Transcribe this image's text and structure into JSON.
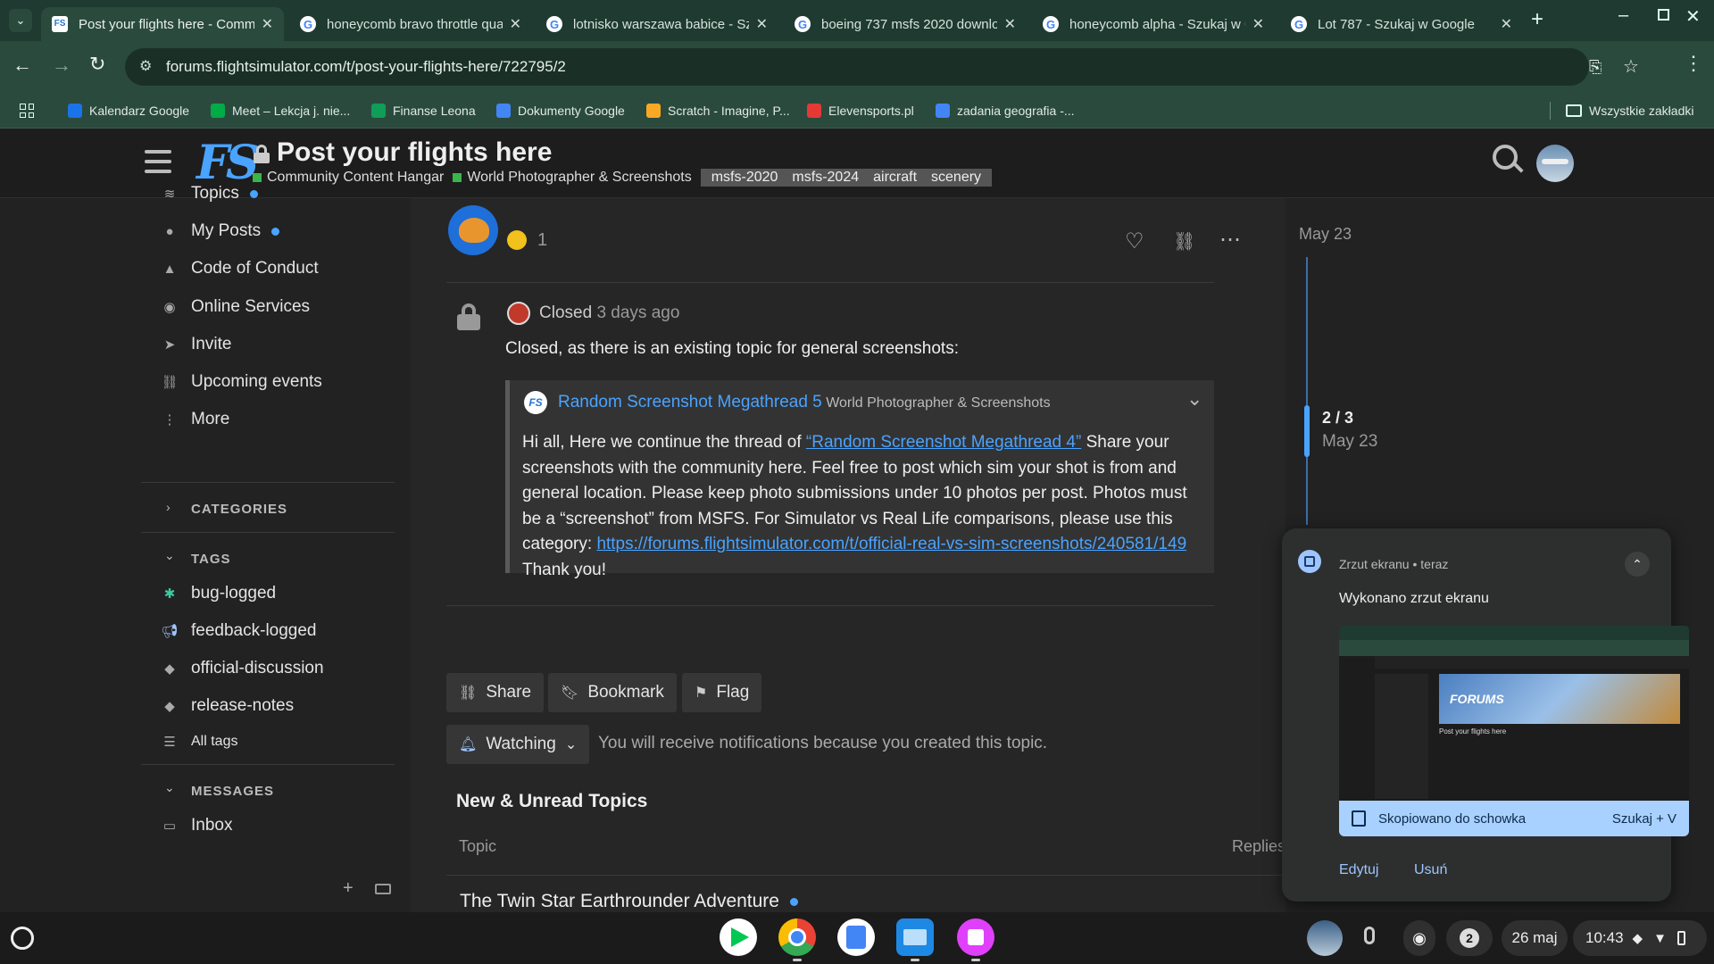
{
  "browser": {
    "tabs": [
      {
        "title": "Post your flights here - Commu",
        "active": true
      },
      {
        "title": "honeycomb bravo throttle qua"
      },
      {
        "title": "lotnisko warszawa babice - Sz"
      },
      {
        "title": "boeing 737 msfs 2020 downlo"
      },
      {
        "title": "honeycomb alpha - Szukaj w G"
      },
      {
        "title": "Lot 787 - Szukaj w Google"
      }
    ],
    "url": "forums.flightsimulator.com/t/post-your-flights-here/722795/2",
    "bookmarks": [
      {
        "label": "Kalendarz Google",
        "color": "#1a73e8"
      },
      {
        "label": "Meet – Lekcja j. nie...",
        "color": "#00ac47"
      },
      {
        "label": "Finanse Leona",
        "color": "#0f9d58"
      },
      {
        "label": "Dokumenty Google",
        "color": "#4285f4"
      },
      {
        "label": "Scratch - Imagine, P...",
        "color": "#f9a825"
      },
      {
        "label": "Elevensports.pl",
        "color": "#e53935"
      },
      {
        "label": "zadania geografia -...",
        "color": "#4285f4"
      }
    ],
    "all_bookmarks": "Wszystkie zakładki"
  },
  "forum": {
    "logo": "FS",
    "topic_title": "Post your flights here",
    "category1": "Community Content Hangar",
    "category2": "World Photographer & Screenshots",
    "tags": [
      "msfs-2020",
      "msfs-2024",
      "aircraft",
      "scenery"
    ],
    "cat1_color": "#3ab54a",
    "cat2_color": "#3ab54a"
  },
  "sidebar": {
    "items": [
      {
        "label": "Topics",
        "icon": "layers-icon",
        "dot": true
      },
      {
        "label": "My Posts",
        "icon": "user-icon",
        "dot": true
      },
      {
        "label": "Code of Conduct",
        "icon": "warning-icon"
      },
      {
        "label": "Online Services",
        "icon": "eye-icon"
      },
      {
        "label": "Invite",
        "icon": "paper-plane-icon"
      },
      {
        "label": "Upcoming events",
        "icon": "link-icon"
      },
      {
        "label": "More",
        "icon": "more-vertical-icon"
      }
    ],
    "categories_heading": "CATEGORIES",
    "tags_heading": "TAGS",
    "tags": [
      {
        "label": "bug-logged",
        "icon": "bug-icon"
      },
      {
        "label": "feedback-logged",
        "icon": "megaphone-icon"
      },
      {
        "label": "official-discussion",
        "icon": "tag-icon"
      },
      {
        "label": "release-notes",
        "icon": "tag-icon"
      }
    ],
    "all_tags": "All tags",
    "messages_heading": "MESSAGES",
    "inbox": "Inbox"
  },
  "post": {
    "reaction_count": "1",
    "closed_label": "Closed",
    "closed_time": "3 days ago",
    "body": "Closed, as there is an existing topic for general screenshots:",
    "quote_title": "Random Screenshot Megathread 5",
    "quote_category": "World Photographer & Screenshots",
    "quote_text_1": "Hi all, Here we continue the thread of ",
    "quote_link_1": "“Random Screenshot Megathread 4”",
    "quote_text_2": " Share your screenshots with the community here. Feel free to post which sim your shot is from and general location. Please keep photo submissions under 10 photos per post. Photos must be a “screenshot” from MSFS. For Simulator vs Real Life comparisons, please use this category: ",
    "quote_link_2": "https://forums.flightsimulator.com/t/official-real-vs-sim-screenshots/240581/149",
    "quote_text_3": " Thank you!"
  },
  "actions": {
    "share": "Share",
    "bookmark": "Bookmark",
    "flag": "Flag",
    "watching": "Watching",
    "watching_note": "You will receive notifications because you created this topic."
  },
  "topics_list": {
    "heading": "New & Unread Topics",
    "col_topic": "Topic",
    "col_replies": "Replies",
    "first_topic": "The Twin Star Earthrounder Adventure"
  },
  "timeline": {
    "top_date": "May 23",
    "position": "2 / 3",
    "position_date": "May 23",
    "progress": 0.67
  },
  "notification": {
    "app": "Zrzut ekranu",
    "time": "teraz",
    "title": "Wykonano zrzut ekranu",
    "copied": "Skopiowano do schowka",
    "search_hint": "Szukaj + V",
    "edit": "Edytuj",
    "delete": "Usuń",
    "thumb_forums_text": "FORUMS",
    "thumb_title": "Post your flights here"
  },
  "shelf": {
    "notif_count": "2",
    "date": "26 maj",
    "time": "10:43"
  }
}
